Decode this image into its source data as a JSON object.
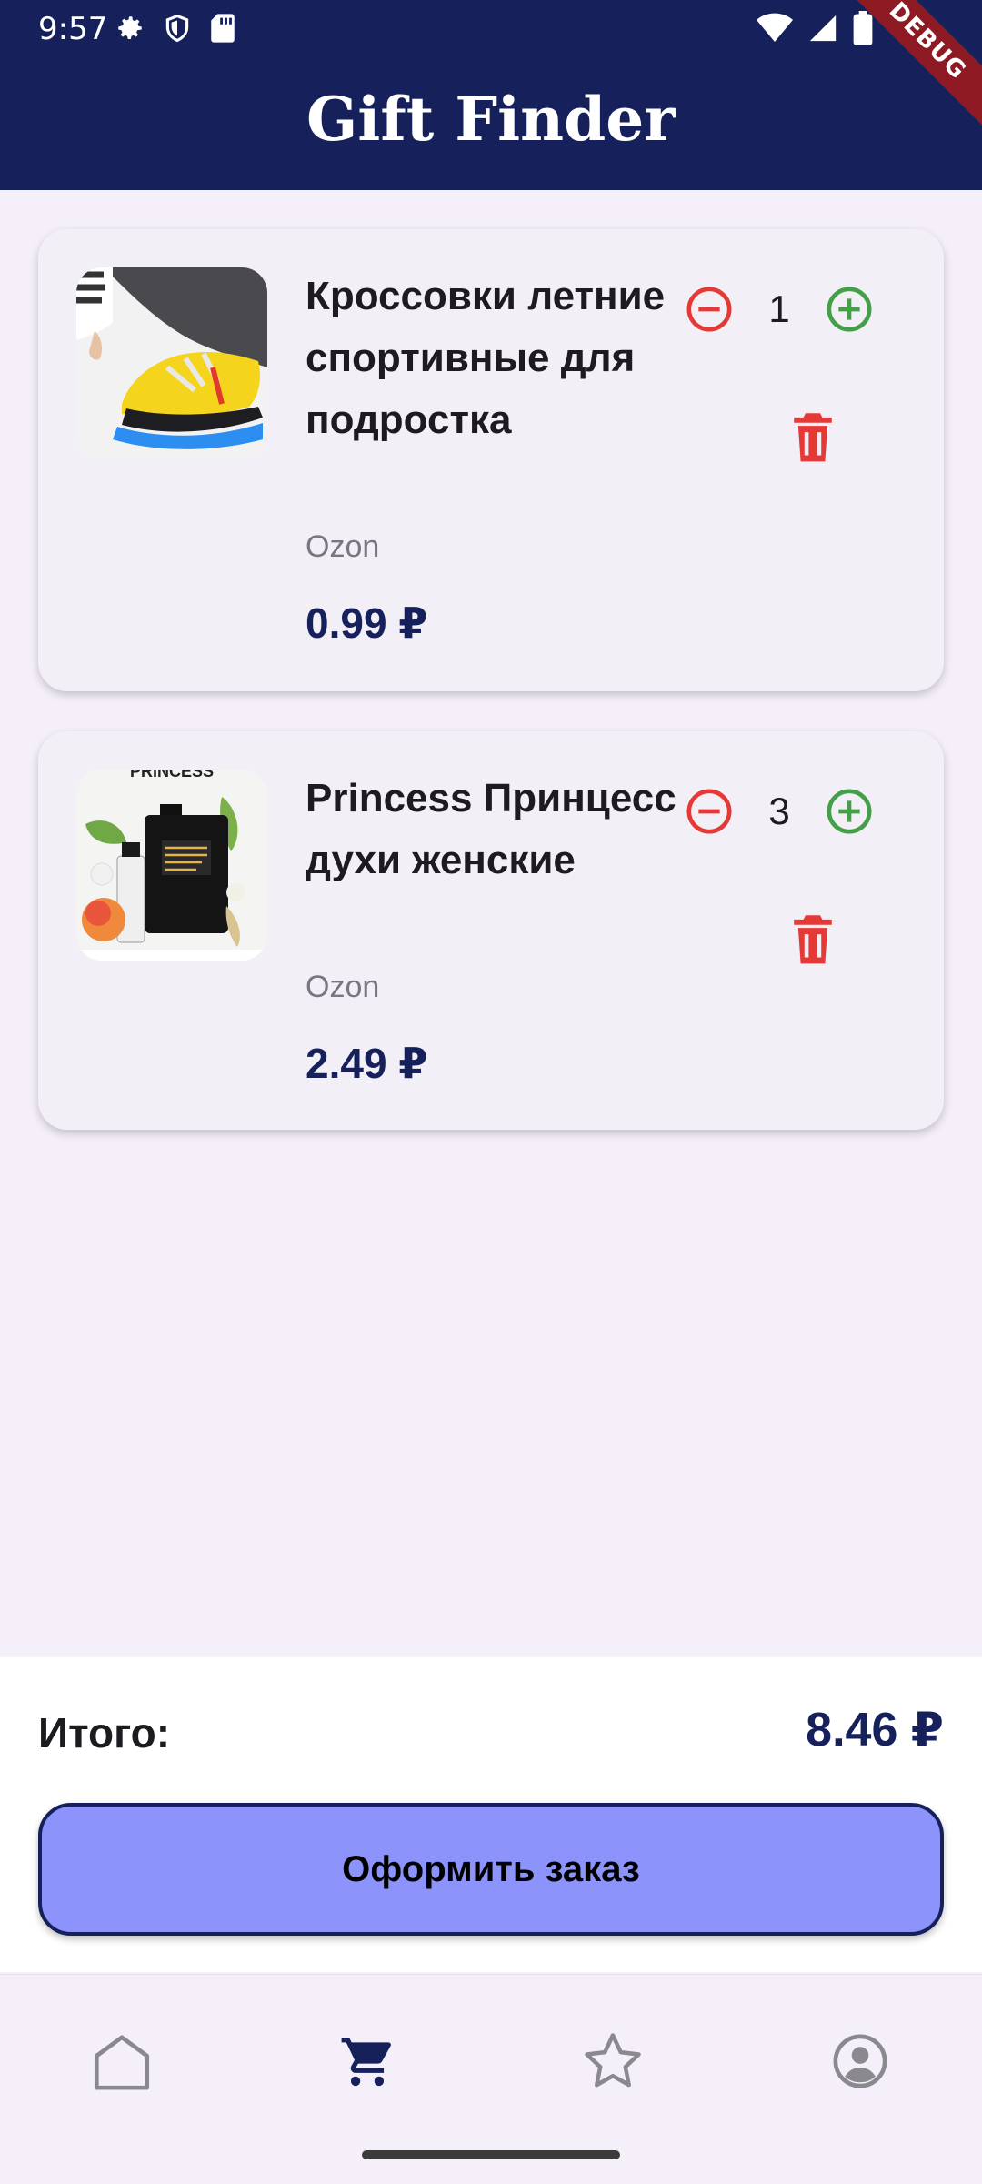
{
  "status_bar": {
    "time": "9:57",
    "debug_label": "DEBUG"
  },
  "app": {
    "title": "Gift Finder"
  },
  "cart": {
    "items": [
      {
        "name": "Кроссовки летние спортивные для подростка",
        "store": "Ozon",
        "price": "0.99 ₽",
        "quantity": "1"
      },
      {
        "name": "Princess Принцесс духи женские",
        "store": "Ozon",
        "price": "2.49 ₽",
        "quantity": "3"
      }
    ]
  },
  "product_image_text": {
    "perfume_banner": "PRINCESS"
  },
  "summary": {
    "total_label": "Итого:",
    "total_value": "8.46 ₽",
    "order_button": "Оформить заказ"
  },
  "nav": {
    "items": [
      {
        "icon": "home-icon",
        "active": false
      },
      {
        "icon": "cart-icon",
        "active": true
      },
      {
        "icon": "star-icon",
        "active": false
      },
      {
        "icon": "profile-icon",
        "active": false
      }
    ]
  },
  "colors": {
    "primary": "#16215c",
    "accent_button": "#8c94fc",
    "minus": "#e53935",
    "plus": "#43a047",
    "background": "#f5eff9"
  }
}
